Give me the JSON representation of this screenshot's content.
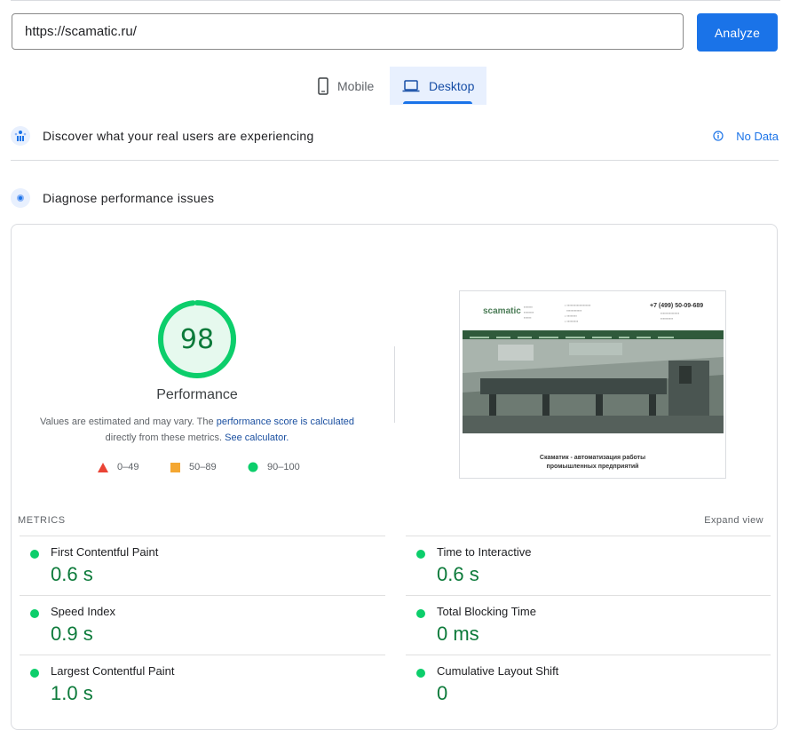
{
  "search": {
    "url_value": "https://scamatic.ru/",
    "analyze_label": "Analyze"
  },
  "tabs": [
    {
      "label": "Mobile",
      "icon": "phone-icon",
      "active": false
    },
    {
      "label": "Desktop",
      "icon": "laptop-icon",
      "active": true
    }
  ],
  "field_data": {
    "title": "Discover what your real users are experiencing",
    "status": "No Data",
    "icon": "users-icon"
  },
  "lab_data": {
    "title": "Diagnose performance issues",
    "icon": "flask-icon"
  },
  "performance": {
    "score": "98",
    "score_fraction": 0.98,
    "title": "Performance",
    "desc_prefix": "Values are estimated and may vary. The ",
    "desc_link1": "performance score is calculated",
    "desc_middle": "directly from these metrics. ",
    "desc_link2": "See calculator.",
    "legend": [
      {
        "range": "0–49",
        "shape": "triangle",
        "color": "#ea4335"
      },
      {
        "range": "50–89",
        "shape": "square",
        "color": "#f4a732"
      },
      {
        "range": "90–100",
        "shape": "circle",
        "color": "#0cce6b"
      }
    ],
    "color": "#0cce6b"
  },
  "screenshot": {
    "logo_text": "scamatic",
    "phone": "+7 (499) 50-09-689",
    "tagline_line1": "Скаматик - автоматизация работы",
    "tagline_line2": "промышленных предприятий"
  },
  "metrics": {
    "label": "METRICS",
    "expand_label": "Expand view",
    "items": [
      {
        "name": "First Contentful Paint",
        "value": "0.6 s"
      },
      {
        "name": "Time to Interactive",
        "value": "0.6 s"
      },
      {
        "name": "Speed Index",
        "value": "0.9 s"
      },
      {
        "name": "Total Blocking Time",
        "value": "0 ms"
      },
      {
        "name": "Largest Contentful Paint",
        "value": "1.0 s"
      },
      {
        "name": "Cumulative Layout Shift",
        "value": "0"
      }
    ]
  }
}
